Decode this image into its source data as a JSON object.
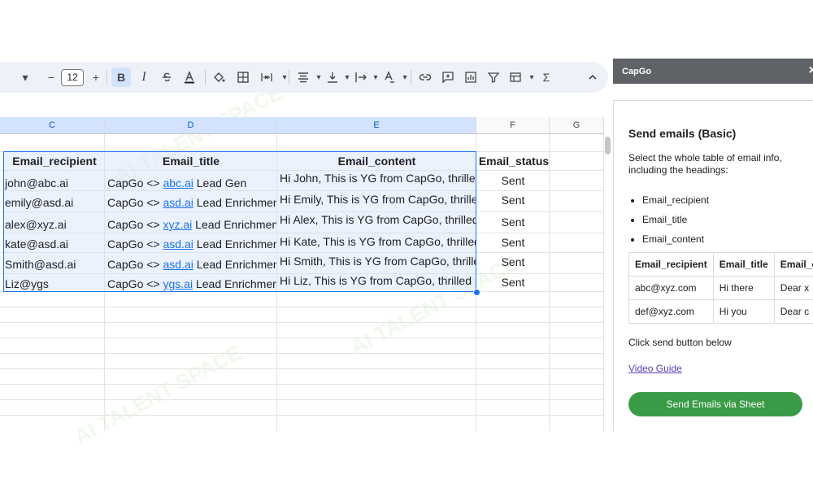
{
  "toolbar": {
    "font_size": "12",
    "bold": "B",
    "italic": "I",
    "sum": "Σ"
  },
  "grid": {
    "columns": [
      "C",
      "D",
      "E",
      "F",
      "G"
    ],
    "headers": [
      "Email_recipient",
      "Email_title",
      "Email_content",
      "Email_status"
    ],
    "rows": [
      {
        "recipient": "john@abc.ai",
        "title_prefix": "CapGo <> ",
        "title_link": "abc.ai",
        "title_suffix": " Lead Gen",
        "content": "Hi John, This is YG from CapGo, thrilled",
        "status": "Sent"
      },
      {
        "recipient": "emily@asd.ai",
        "title_prefix": "CapGo <> ",
        "title_link": "asd.ai",
        "title_suffix": " Lead Enrichment",
        "content": "Hi Emily, This is YG from CapGo, thrilled",
        "status": "Sent"
      },
      {
        "recipient": "alex@xyz.ai",
        "title_prefix": "CapGo <> ",
        "title_link": "xyz.ai",
        "title_suffix": " Lead Enrichment",
        "content": "Hi Alex, This is YG from CapGo, thrilled",
        "status": "Sent"
      },
      {
        "recipient": "kate@asd.ai",
        "title_prefix": "CapGo <> ",
        "title_link": "asd.ai",
        "title_suffix": " Lead Enrichment",
        "content": "Hi Kate, This is YG from CapGo, thrilled",
        "status": "Sent"
      },
      {
        "recipient": "Smith@asd.ai",
        "title_prefix": "CapGo <> ",
        "title_link": "asd.ai",
        "title_suffix": " Lead Enrichment",
        "content": "Hi Smith, This is YG from CapGo, thrilled",
        "status": "Sent"
      },
      {
        "recipient": "Liz@ygs",
        "title_prefix": "CapGo <> ",
        "title_link": "ygs.ai",
        "title_suffix": " Lead Enrichment",
        "content": "Hi Liz, This is YG from CapGo, thrilled",
        "status": "Sent"
      }
    ]
  },
  "panel": {
    "app_name": "CapGo",
    "close": "×",
    "title": "Send emails (Basic)",
    "description": "Select the whole table of email info, including the headings:",
    "fields": [
      "Email_recipient",
      "Email_title",
      "Email_content"
    ],
    "table_headers": [
      "Email_recipient",
      "Email_title",
      "Email_c"
    ],
    "table_rows": [
      [
        "abc@xyz.com",
        "Hi there",
        "Dear x"
      ],
      [
        "def@xyz.com",
        "Hi you",
        "Dear c"
      ]
    ],
    "note": "Click send button below",
    "video_link": "Video Guide",
    "send_button": "Send Emails via Sheet"
  },
  "watermark": "AI TALENT SPACE",
  "colors": {
    "selection": "#1a73e8",
    "panel_header": "#5f6368",
    "send_button": "#3a9b46"
  }
}
